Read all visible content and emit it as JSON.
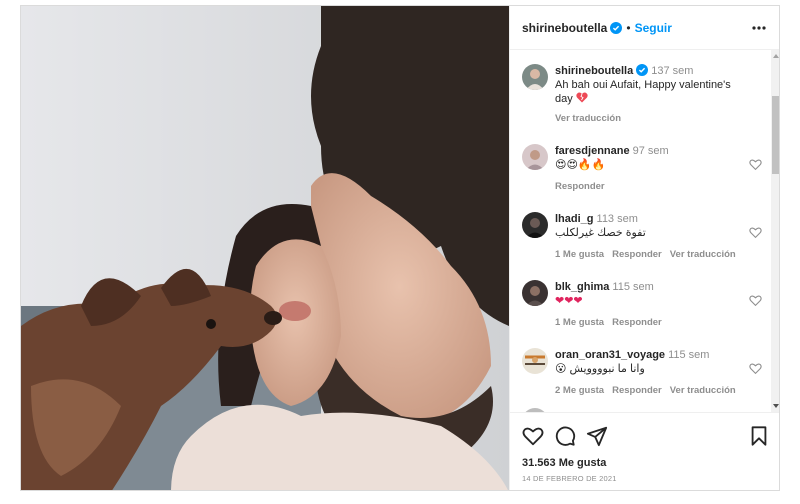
{
  "post": {
    "username": "shirineboutella",
    "separator": "•",
    "follow_label": "Seguir",
    "photo_icon": "post-photo",
    "caption": {
      "username": "shirineboutella",
      "time": "137 sem",
      "text": "Ah bah oui Aufait, Happy valentine's day",
      "emoji": "broken-heart",
      "translate_label": "Ver traducción"
    }
  },
  "comments": [
    {
      "username": "faresdjennane",
      "time": "97 sem",
      "text": "😍😍🔥🔥",
      "actions": [
        "Responder"
      ]
    },
    {
      "username": "lhadi_g",
      "time": "113 sem",
      "text": "تفوة خصك غيرلكلب",
      "actions": [
        "1 Me gusta",
        "Responder",
        "Ver traducción"
      ]
    },
    {
      "username": "blk_ghima",
      "time": "115 sem",
      "text": "❤❤❤",
      "actions": [
        "1 Me gusta",
        "Responder"
      ]
    },
    {
      "username": "oran_oran31_voyage",
      "time": "115 sem",
      "text": "😮 وانا ما نبوووويش",
      "actions": [
        "2 Me gusta",
        "Responder",
        "Ver traducción"
      ]
    }
  ],
  "footer": {
    "likes": "31.563 Me gusta",
    "date": "14 DE FEBRERO DE 2021"
  },
  "colors": {
    "accent": "#0095f6",
    "muted": "#8e8e8e",
    "text": "#262626",
    "heart_red": "#ed4956"
  }
}
